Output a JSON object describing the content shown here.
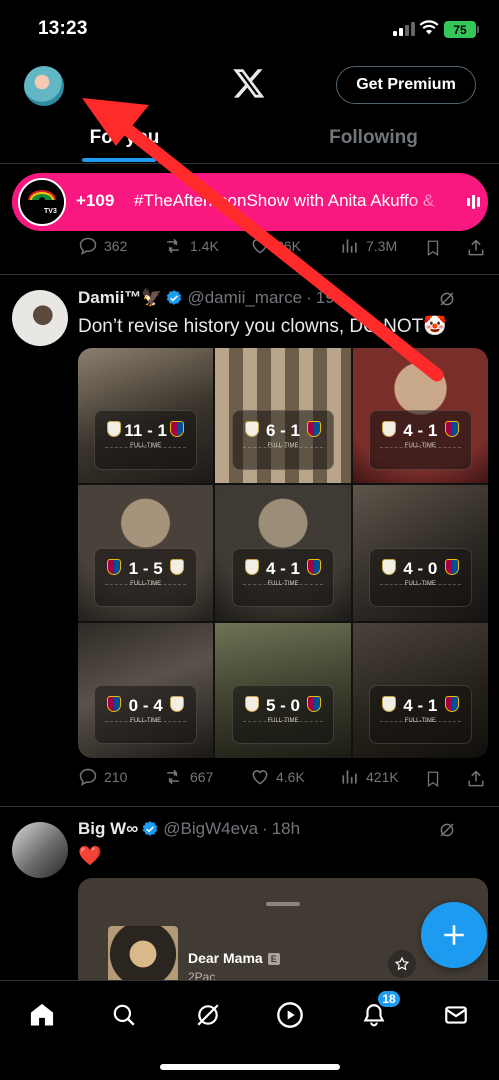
{
  "status_bar": {
    "time": "13:23",
    "battery": "75"
  },
  "header": {
    "premium_label": "Get Premium",
    "logo_icon": "x-logo-icon",
    "avatar_icon": "profile-avatar"
  },
  "tabs": [
    {
      "label": "For you",
      "active": true
    },
    {
      "label": "Following",
      "active": false
    }
  ],
  "spaces": {
    "count": "+109",
    "title": "#TheAfternoonShow with Anita Akuffo &"
  },
  "prev_post_actions": {
    "replies": "362",
    "reposts": "1.4K",
    "likes": "86K",
    "views": "7.3M"
  },
  "posts": [
    {
      "name": "Damii™🦅",
      "handle": "@damii_marce",
      "time": "19h",
      "text": "Don’t revise history you clowns, DO NOT🤡",
      "actions": {
        "replies": "210",
        "reposts": "667",
        "likes": "4.6K",
        "views": "421K"
      },
      "media_scores": [
        "11 - 1",
        "6 - 1",
        "4 - 1",
        "1 - 5",
        "4 - 1",
        "4 - 0",
        "0 - 4",
        "5 - 0",
        "4 - 1"
      ],
      "media_caption": "FULL-TIME"
    },
    {
      "name": "Big W∞",
      "handle": "@BigW4eva",
      "time": "18h",
      "text": "❤️",
      "attachment": {
        "title": "Dear Mama",
        "explicit": "E",
        "artist": "2Pac"
      }
    }
  ],
  "bottom_nav": {
    "notifications_badge": "18"
  },
  "colors": {
    "accent": "#1d9bf0",
    "spaces": "#f91880",
    "background": "#000000",
    "muted": "#71767b"
  }
}
